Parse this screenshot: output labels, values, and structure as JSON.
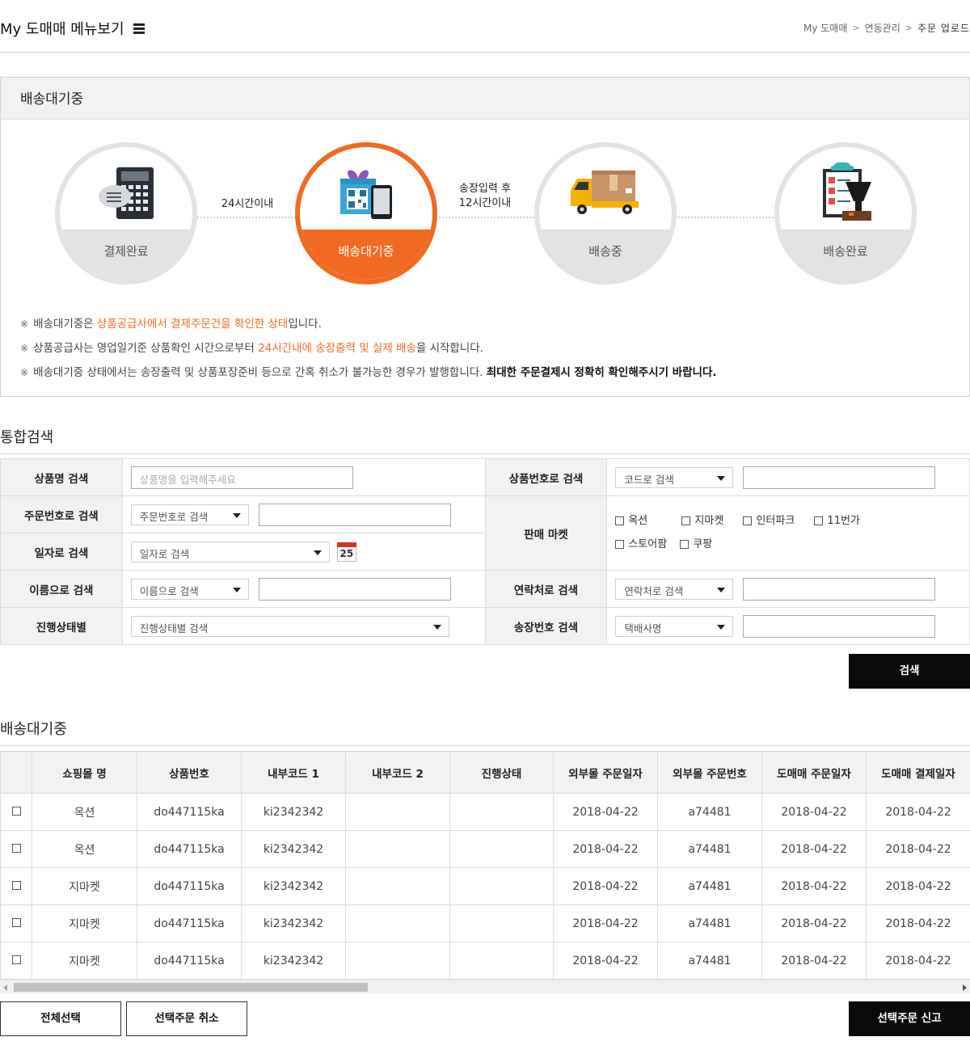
{
  "header": {
    "title": "My 도매매 메뉴보기",
    "breadcrumb": [
      "My 도매매",
      "연동관리",
      "주문 업로드"
    ]
  },
  "status": {
    "box_title": "배송대기중",
    "steps": [
      {
        "label": "결제완료",
        "icon": "calculator-icon",
        "active": false
      },
      {
        "label": "배송대기중",
        "icon": "gift-tablet-icon",
        "active": true
      },
      {
        "label": "배송중",
        "icon": "truck-icon",
        "active": false
      },
      {
        "label": "배송완료",
        "icon": "checklist-icon",
        "active": false
      }
    ],
    "connector_1": "24시간이내",
    "connector_2_line1": "송장입력 후",
    "connector_2_line2": "12시간이내",
    "notes": [
      {
        "marker": "※",
        "a": "배송대기중은 ",
        "hl": "상품공급사에서 결제주문건을 확인한 상태",
        "b": "입니다."
      },
      {
        "marker": "※",
        "a": "상품공급사는 영업일기준 상품확인 시간으로부터 ",
        "hl": "24시간내에 송장출력 및 실제 배송",
        "b": "을 시작합니다."
      },
      {
        "marker": "※",
        "a": "배송대기중 상태에서는 송장출력 및 상품포장준비 등으로 간혹 취소가 불가능한 경우가 발행합니다. ",
        "bold": "최대한 주문결제시 정확히 확인해주시기 바랍니다."
      }
    ]
  },
  "search": {
    "section_title": "통합검색",
    "product_name": {
      "label": "상품명 검색",
      "placeholder": "상품명을 입력해주세요"
    },
    "product_no": {
      "label": "상품번호로 검색",
      "select": "코드로 검색"
    },
    "order_no": {
      "label": "주문번호로 검색",
      "select": "주문번호로 검색"
    },
    "market": {
      "label": "판매 마켓",
      "options": [
        "옥션",
        "지마켓",
        "인터파크",
        "11번가",
        "스토어팜",
        "쿠팡"
      ]
    },
    "date": {
      "label": "일자로 검색",
      "select": "일자로 검색",
      "calendar_day": "25"
    },
    "name": {
      "label": "이름으로 검색",
      "select": "이름으로 검색"
    },
    "contact": {
      "label": "연락처로 검색",
      "select": "연락처로 검색"
    },
    "progress": {
      "label": "진행상태별",
      "select": "진행상태별 검색"
    },
    "invoice": {
      "label": "송장번호 검색",
      "select": "택배사명"
    },
    "search_button": "검색"
  },
  "list": {
    "section_title": "배송대기중",
    "columns": [
      "쇼핑몰 명",
      "상품번호",
      "내부코드 1",
      "내부코드 2",
      "진행상태",
      "외부몰 주문일자",
      "외부몰 주문번호",
      "도매매 주문일자",
      "도매매 결제일자"
    ],
    "rows": [
      [
        "옥션",
        "do447115ka",
        "ki2342342",
        "",
        "",
        "2018-04-22",
        "a74481",
        "2018-04-22",
        "2018-04-22"
      ],
      [
        "옥션",
        "do447115ka",
        "ki2342342",
        "",
        "",
        "2018-04-22",
        "a74481",
        "2018-04-22",
        "2018-04-22"
      ],
      [
        "지마켓",
        "do447115ka",
        "ki2342342",
        "",
        "",
        "2018-04-22",
        "a74481",
        "2018-04-22",
        "2018-04-22"
      ],
      [
        "지마켓",
        "do447115ka",
        "ki2342342",
        "",
        "",
        "2018-04-22",
        "a74481",
        "2018-04-22",
        "2018-04-22"
      ],
      [
        "지마켓",
        "do447115ka",
        "ki2342342",
        "",
        "",
        "2018-04-22",
        "a74481",
        "2018-04-22",
        "2018-04-22"
      ]
    ]
  },
  "footer_buttons": {
    "select_all": "전체선택",
    "cancel_selected": "선택주문 취소",
    "report_selected": "선택주문 신고"
  },
  "colors": {
    "accent": "#f06a24",
    "highlight": "#ef6b2a",
    "button": "#0a0a0a",
    "step_gray": "#e3e3e3"
  }
}
